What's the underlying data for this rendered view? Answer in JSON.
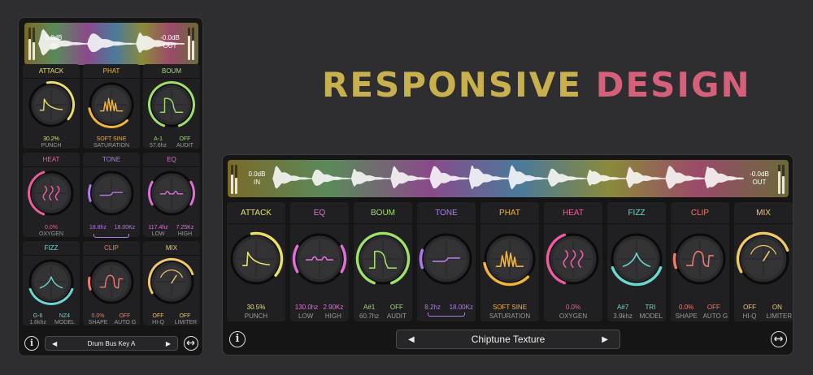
{
  "headline": {
    "word1": "RESPONSIVE",
    "word2": "DESIGN",
    "color1": "#c8b04e",
    "color2": "#d4607a"
  },
  "meter": {
    "in_db": "0.0dB",
    "in_label": "IN",
    "out_db": "-0.0dB",
    "out_label": "OUT"
  },
  "small": {
    "preset_prev": "◀",
    "preset_next": "▶",
    "preset_name": "Drum Bus Key A",
    "panels": [
      {
        "title": "ATTACK",
        "color": "#e8e06a",
        "shape": "attack",
        "v1": "30.2%",
        "l1": "PUNCH",
        "v2": "",
        "l2": ""
      },
      {
        "title": "PHAT",
        "color": "#f2b43a",
        "shape": "phat",
        "v1": "SOFT SINE",
        "l1": "SATURATION",
        "v2": "",
        "l2": ""
      },
      {
        "title": "BOUM",
        "color": "#9ee06a",
        "shape": "boum",
        "v1": "A-1",
        "l1": "57.6hz",
        "v2": "OFF",
        "l2": "AUDIT"
      },
      {
        "title": "HEAT",
        "color": "#f05aa0",
        "shape": "heat",
        "v1": "0.0%",
        "l1": "OXYGEN",
        "v2": "",
        "l2": ""
      },
      {
        "title": "TONE",
        "color": "#b07ae8",
        "shape": "tone",
        "v1": "18.8hz",
        "l1": "",
        "v2": "18.00Kz",
        "l2": ""
      },
      {
        "title": "EQ",
        "color": "#e070d8",
        "shape": "eq",
        "v1": "117.4hz",
        "l1": "LOW",
        "v2": "7.25Kz",
        "l2": "HIGH"
      },
      {
        "title": "FIZZ",
        "color": "#6ad8d0",
        "shape": "fizz",
        "v1": "G-6",
        "l1": "1.6khz",
        "v2": "NZ4",
        "l2": "MODEL"
      },
      {
        "title": "CLIP",
        "color": "#f07a6a",
        "shape": "clip",
        "v1": "0.0%",
        "l1": "SHAPE",
        "v2": "OFF",
        "l2": "AUTO G"
      },
      {
        "title": "MIX",
        "color": "#f0c86a",
        "shape": "mix",
        "v1": "OFF",
        "l1": "HI-Q",
        "v2": "OFF",
        "l2": "LIMITER"
      }
    ]
  },
  "large": {
    "preset_prev": "◀",
    "preset_next": "▶",
    "preset_name": "Chiptune Texture",
    "panels": [
      {
        "title": "ATTACK",
        "color": "#e8e06a",
        "shape": "attack",
        "v1": "30.5%",
        "l1": "PUNCH",
        "v2": "",
        "l2": ""
      },
      {
        "title": "EQ",
        "color": "#e070d8",
        "shape": "eq",
        "v1": "130.0hz",
        "l1": "LOW",
        "v2": "2.90Kz",
        "l2": "HIGH"
      },
      {
        "title": "BOUM",
        "color": "#9ee06a",
        "shape": "boum",
        "v1": "A#1",
        "l1": "60.7hz",
        "v2": "OFF",
        "l2": "AUDIT"
      },
      {
        "title": "TONE",
        "color": "#b07ae8",
        "shape": "tone",
        "v1": "8.2hz",
        "l1": "",
        "v2": "18.00Kz",
        "l2": ""
      },
      {
        "title": "PHAT",
        "color": "#f2b43a",
        "shape": "phat",
        "v1": "SOFT SINE",
        "l1": "SATURATION",
        "v2": "",
        "l2": ""
      },
      {
        "title": "HEAT",
        "color": "#f05aa0",
        "shape": "heat",
        "v1": "0.0%",
        "l1": "OXYGEN",
        "v2": "",
        "l2": ""
      },
      {
        "title": "FIZZ",
        "color": "#6ad8d0",
        "shape": "fizz",
        "v1": "A#7",
        "l1": "3.9khz",
        "v2": "TRI",
        "l2": "MODEL"
      },
      {
        "title": "CLIP",
        "color": "#f07a6a",
        "shape": "clip",
        "v1": "0.0%",
        "l1": "SHAPE",
        "v2": "OFF",
        "l2": "AUTO G"
      },
      {
        "title": "MIX",
        "color": "#f0c86a",
        "shape": "mix",
        "v1": "OFF",
        "l1": "HI-Q",
        "v2": "ON",
        "l2": "LIMITER"
      }
    ]
  },
  "icons": {
    "info": "i"
  }
}
